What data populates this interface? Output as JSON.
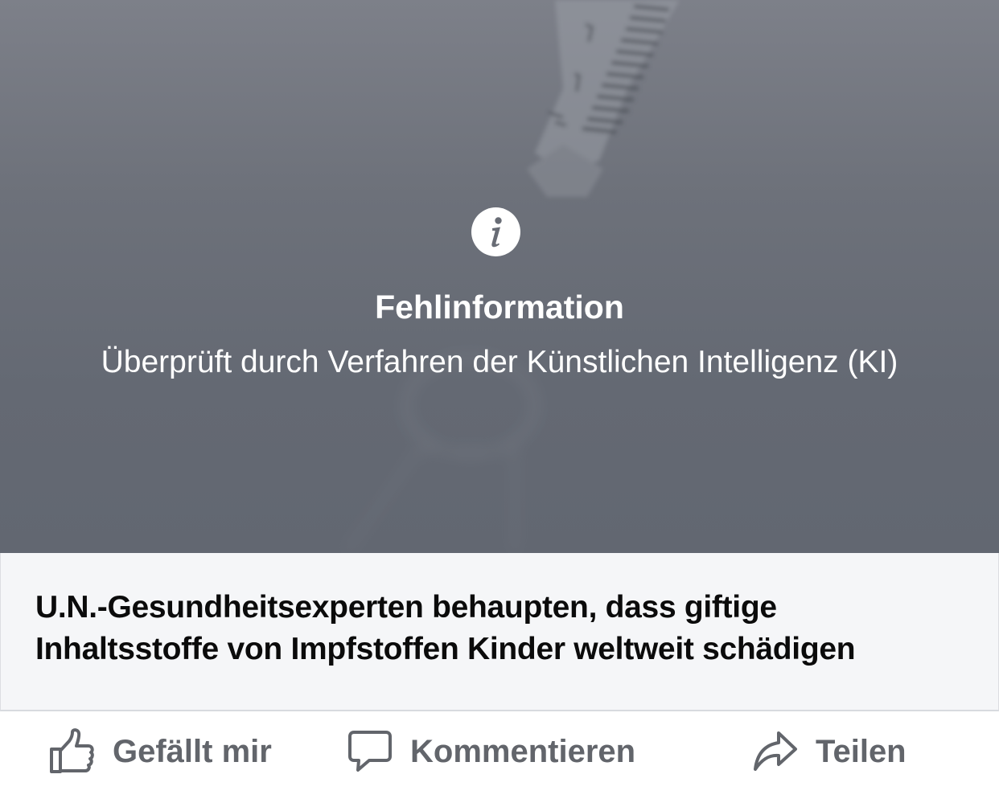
{
  "warning": {
    "title": "Fehlinformation",
    "subtitle": "Überprüft durch Verfahren der Künstlichen Intelligenz (KI)",
    "icon": "info-icon"
  },
  "link_preview": {
    "headline": "U.N.-Gesundheitsexperten behaupten, dass giftige Inhaltsstoffe von Impfstoffen Kinder weltweit schädigen"
  },
  "actions": {
    "like_label": "Gefällt mir",
    "comment_label": "Kommentieren",
    "share_label": "Teilen"
  },
  "colors": {
    "overlay": "#686c75",
    "link_box": "#f5f6f8",
    "action_text": "#62656b"
  }
}
